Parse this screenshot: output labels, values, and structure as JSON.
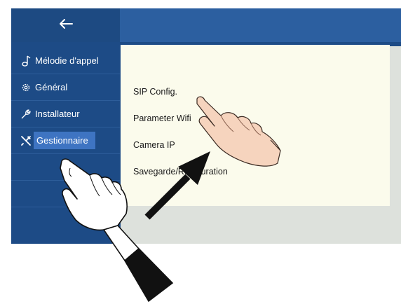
{
  "header": {
    "back_icon": "arrow-left-icon"
  },
  "sidebar": {
    "items": [
      {
        "label": "Mélodie d'appel",
        "icon": "music-note-icon"
      },
      {
        "label": "Général",
        "icon": "gear-icon"
      },
      {
        "label": "Installateur",
        "icon": "wrench-icon"
      },
      {
        "label": "Gestionnaire",
        "icon": "tools-icon",
        "active": true
      }
    ]
  },
  "menu": {
    "items": [
      "SIP Config.",
      "Parameter Wifi",
      "Camera IP",
      "Savegarde/Restauration"
    ]
  },
  "colors": {
    "sidebar": "#1d4b86",
    "header_right": "#2c5fa0",
    "active_item": "#3e74c2",
    "content_bg": "#fbfbec",
    "arrow": "#111111"
  },
  "illustration": {
    "hands": [
      "pointing-hand-icon",
      "pointing-hand-icon"
    ],
    "arrow": "diagonal-arrow-icon"
  }
}
